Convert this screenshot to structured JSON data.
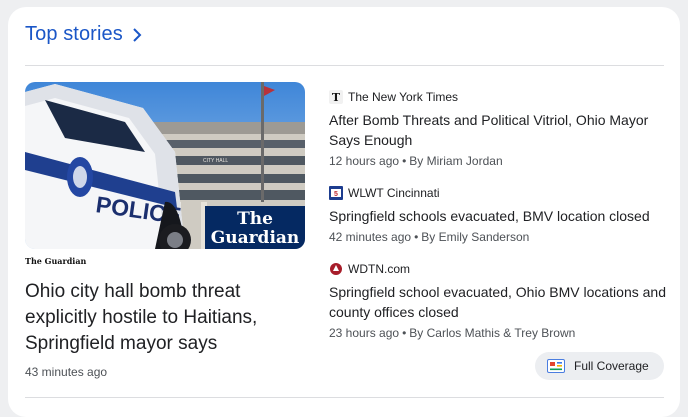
{
  "header": {
    "title": "Top stories"
  },
  "hero": {
    "image_caption": "The Guardian",
    "source": "The Guardian",
    "headline": "Ohio city hall bomb threat explicitly hostile to Haitians, Springfield mayor says",
    "time": "43 minutes ago",
    "police_text": "POLICE",
    "building_text": "CITY HALL"
  },
  "stories": [
    {
      "source": "The New York Times",
      "icon": "nyt-logo-icon",
      "title": "After Bomb Threats and Political Vitriol, Ohio Mayor Says Enough",
      "time": "12 hours ago",
      "author": "By Miriam Jordan"
    },
    {
      "source": "WLWT Cincinnati",
      "icon": "wlwt-logo-icon",
      "title": "Springfield schools evacuated, BMV location closed",
      "time": "42 minutes ago",
      "author": "By Emily Sanderson"
    },
    {
      "source": "WDTN.com",
      "icon": "wdtn-logo-icon",
      "title": "Springfield school evacuated, Ohio BMV locations and county offices closed",
      "time": "23 hours ago",
      "author": "By Carlos Mathis & Trey Brown"
    }
  ],
  "full_coverage": {
    "label": "Full Coverage",
    "icon": "full-coverage-icon"
  },
  "colors": {
    "link": "#1a56c7",
    "text": "#202124",
    "meta": "#4d5156",
    "background": "#eeeff1",
    "card": "#ffffff"
  }
}
